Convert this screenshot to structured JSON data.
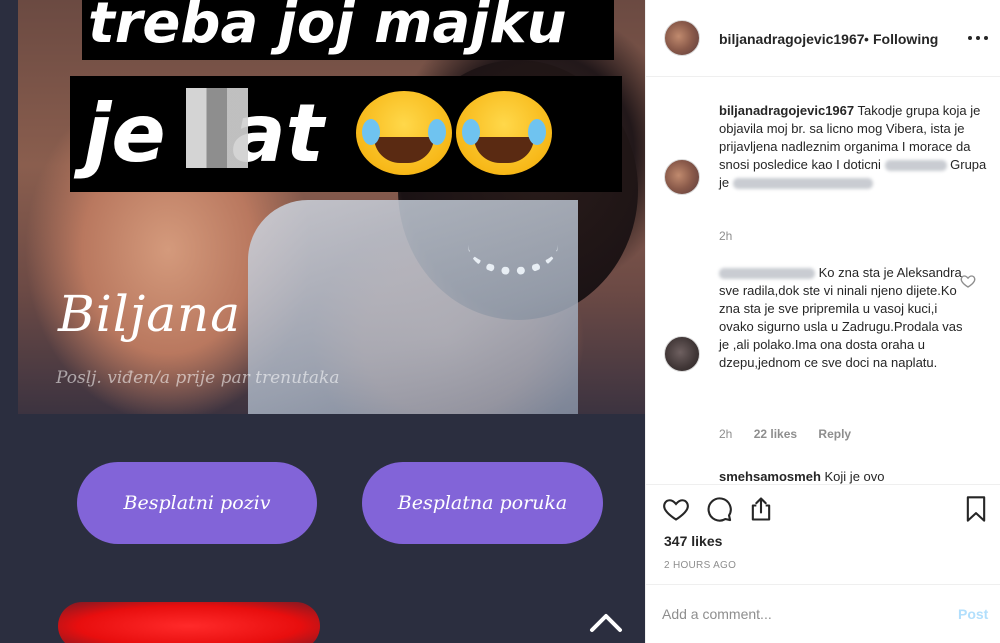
{
  "story": {
    "caption_line_1": "treba joj majku",
    "caption_line_2": "je",
    "caption_line_2_end": "at",
    "name": "Biljana",
    "status": "Poslj. viđen/a prije par trenutaka",
    "call_button": "Besplatni poziv",
    "message_button": "Besplatna poruka"
  },
  "header": {
    "username": "biljanadragojevic1967",
    "separator": "•",
    "follow_status": "Following"
  },
  "comments": [
    {
      "username": "biljanadragojevic1967",
      "text_1": "Takodje grupa koja je objavila moj br. sa licno mog Vibera, ista je prijavljena nadleznim organima I morace da snosi posledice kao I doticni",
      "text_2": "Grupa je",
      "time": "2h"
    },
    {
      "text": "Ko zna sta je Aleksandra sve radila,dok ste vi ninali njeno dijete.Ko zna sta je sve pripremila u vasoj kuci,i ovako sigurno usla u Zadrugu.Prodala vas je ,ali polako.Ima ona dosta oraha u dzepu,jednom ce sve doci na naplatu.",
      "time": "2h",
      "likes": "22 likes",
      "reply": "Reply"
    },
    {
      "username": "smehsamosmeh",
      "text": "Koji je ovo"
    }
  ],
  "actions": {
    "likes": "347 likes",
    "timestamp": "2 HOURS AGO"
  },
  "comment_box": {
    "placeholder": "Add a comment...",
    "post_label": "Post"
  },
  "colors": {
    "button_purple": "#8264d8",
    "story_background": "#2b2e3f",
    "post_disabled": "#b2dffc",
    "meta_gray": "#8e8e8e"
  }
}
